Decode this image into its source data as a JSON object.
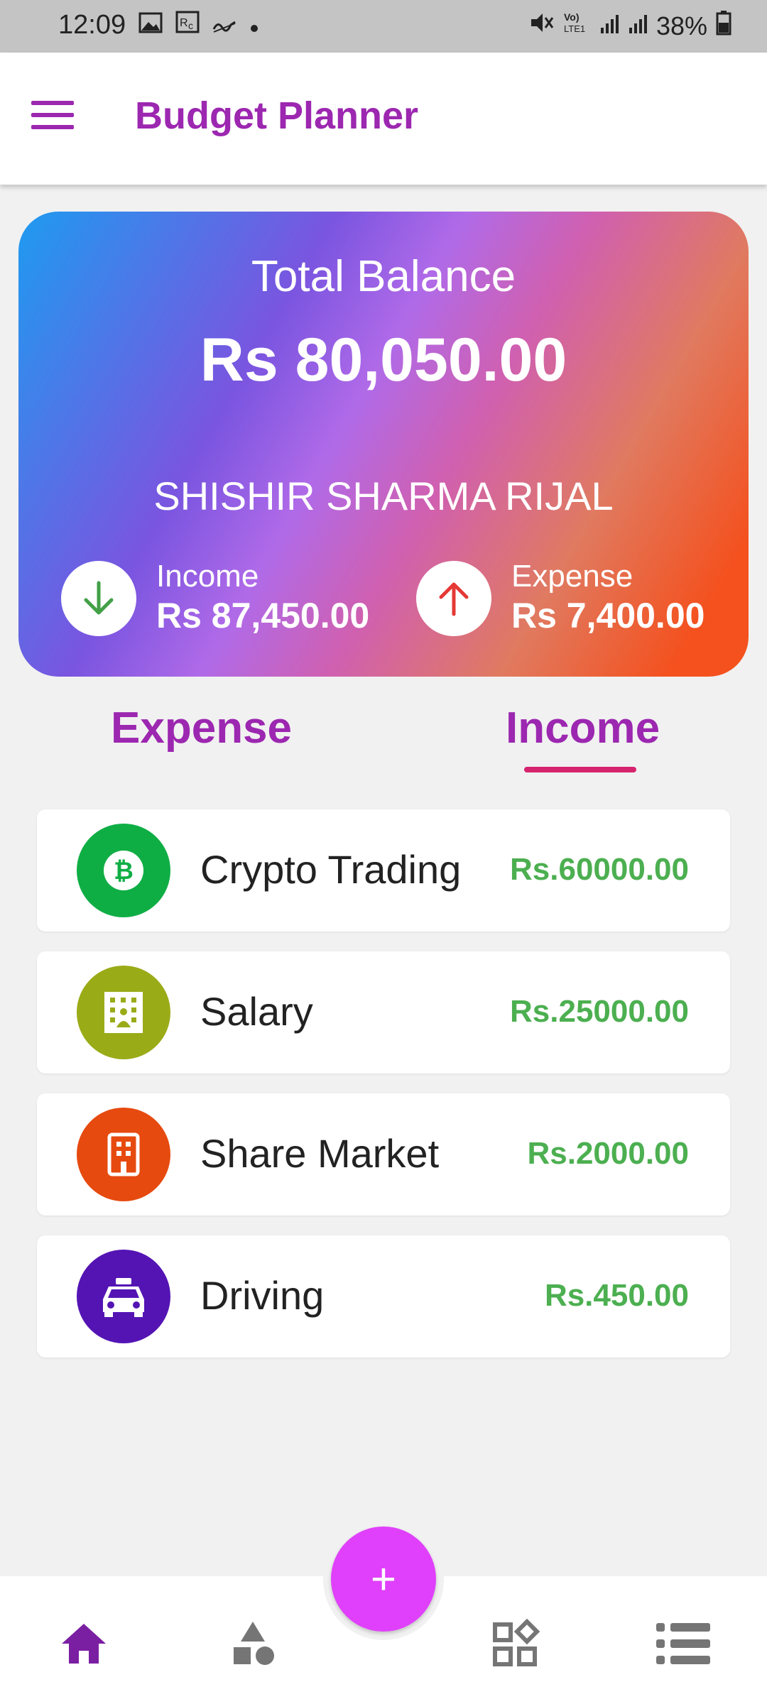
{
  "status_bar": {
    "time": "12:09",
    "battery": "38%",
    "icons": [
      "gallery-icon",
      "reminder-icon",
      "wave-icon",
      "dot-icon",
      "mute-icon",
      "volte-icon",
      "signal-icon",
      "signal-icon",
      "battery-icon"
    ]
  },
  "app_bar": {
    "title": "Budget Planner",
    "menu_icon": "hamburger-menu-icon"
  },
  "balance_card": {
    "title": "Total Balance",
    "amount": "Rs 80,050.00",
    "name": "SHISHIR SHARMA RIJAL",
    "income": {
      "label": "Income",
      "value": "Rs 87,450.00",
      "icon": "arrow-down-icon",
      "color": "#43a047"
    },
    "expense": {
      "label": "Expense",
      "value": "Rs 7,400.00",
      "icon": "arrow-up-icon",
      "color": "#e53935"
    }
  },
  "tabs": {
    "expense": "Expense",
    "income": "Income",
    "active": "income"
  },
  "transactions": [
    {
      "name": "Crypto Trading",
      "amount": "Rs.60000.00",
      "icon": "bitcoin-icon",
      "color": "#0fae45"
    },
    {
      "name": "Salary",
      "amount": "Rs.25000.00",
      "icon": "office-building-icon",
      "color": "#9aab18"
    },
    {
      "name": "Share Market",
      "amount": "Rs.2000.00",
      "icon": "building-icon",
      "color": "#e64a0f"
    },
    {
      "name": "Driving",
      "amount": "Rs.450.00",
      "icon": "taxi-icon",
      "color": "#5414b4"
    }
  ],
  "fab": {
    "label": "+"
  },
  "bottom_nav": [
    "home-icon",
    "shapes-icon",
    "widgets-icon",
    "list-icon"
  ],
  "colors": {
    "accent": "#9c27b0",
    "amount_green": "#4caf50",
    "tab_underline": "#d6246e",
    "fab": "#e040fb"
  }
}
